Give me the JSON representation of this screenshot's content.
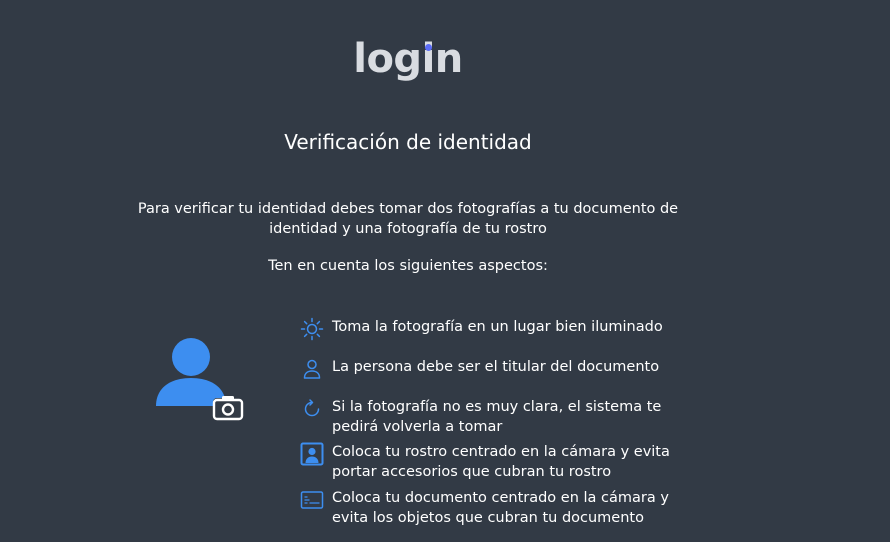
{
  "header": {
    "logo_text_prefix": "log",
    "logo_text_i": "i",
    "logo_text_suffix": "n"
  },
  "page": {
    "title": "Verificación de identidad",
    "intro": "Para verificar tu identidad debes tomar dos fotografías a tu documento de identidad y una fotografía de tu rostro",
    "aspects_heading": "Ten en cuenta los siguientes aspectos:"
  },
  "tips": [
    {
      "icon": "sun-icon",
      "text": "Toma la fotografía en un lugar bien iluminado"
    },
    {
      "icon": "person-icon",
      "text": "La persona debe ser el titular del documento"
    },
    {
      "icon": "refresh-icon",
      "text": "Si la fotografía no es muy clara, el sistema te pedirá volverla a tomar"
    },
    {
      "icon": "portrait-frame-icon",
      "text": "Coloca tu rostro centrado en la cámara y evita portar accesorios que cubran tu rostro"
    },
    {
      "icon": "id-card-icon",
      "text": "Coloca tu documento centrado en la cámara y evita los objetos que cubran tu documento"
    }
  ],
  "illustration": {
    "icon": "user-camera-icon"
  },
  "colors": {
    "background": "#323a45",
    "accent": "#3d8ef0",
    "logo": "#d9dce1",
    "logo_dot": "#5b6cf5"
  }
}
